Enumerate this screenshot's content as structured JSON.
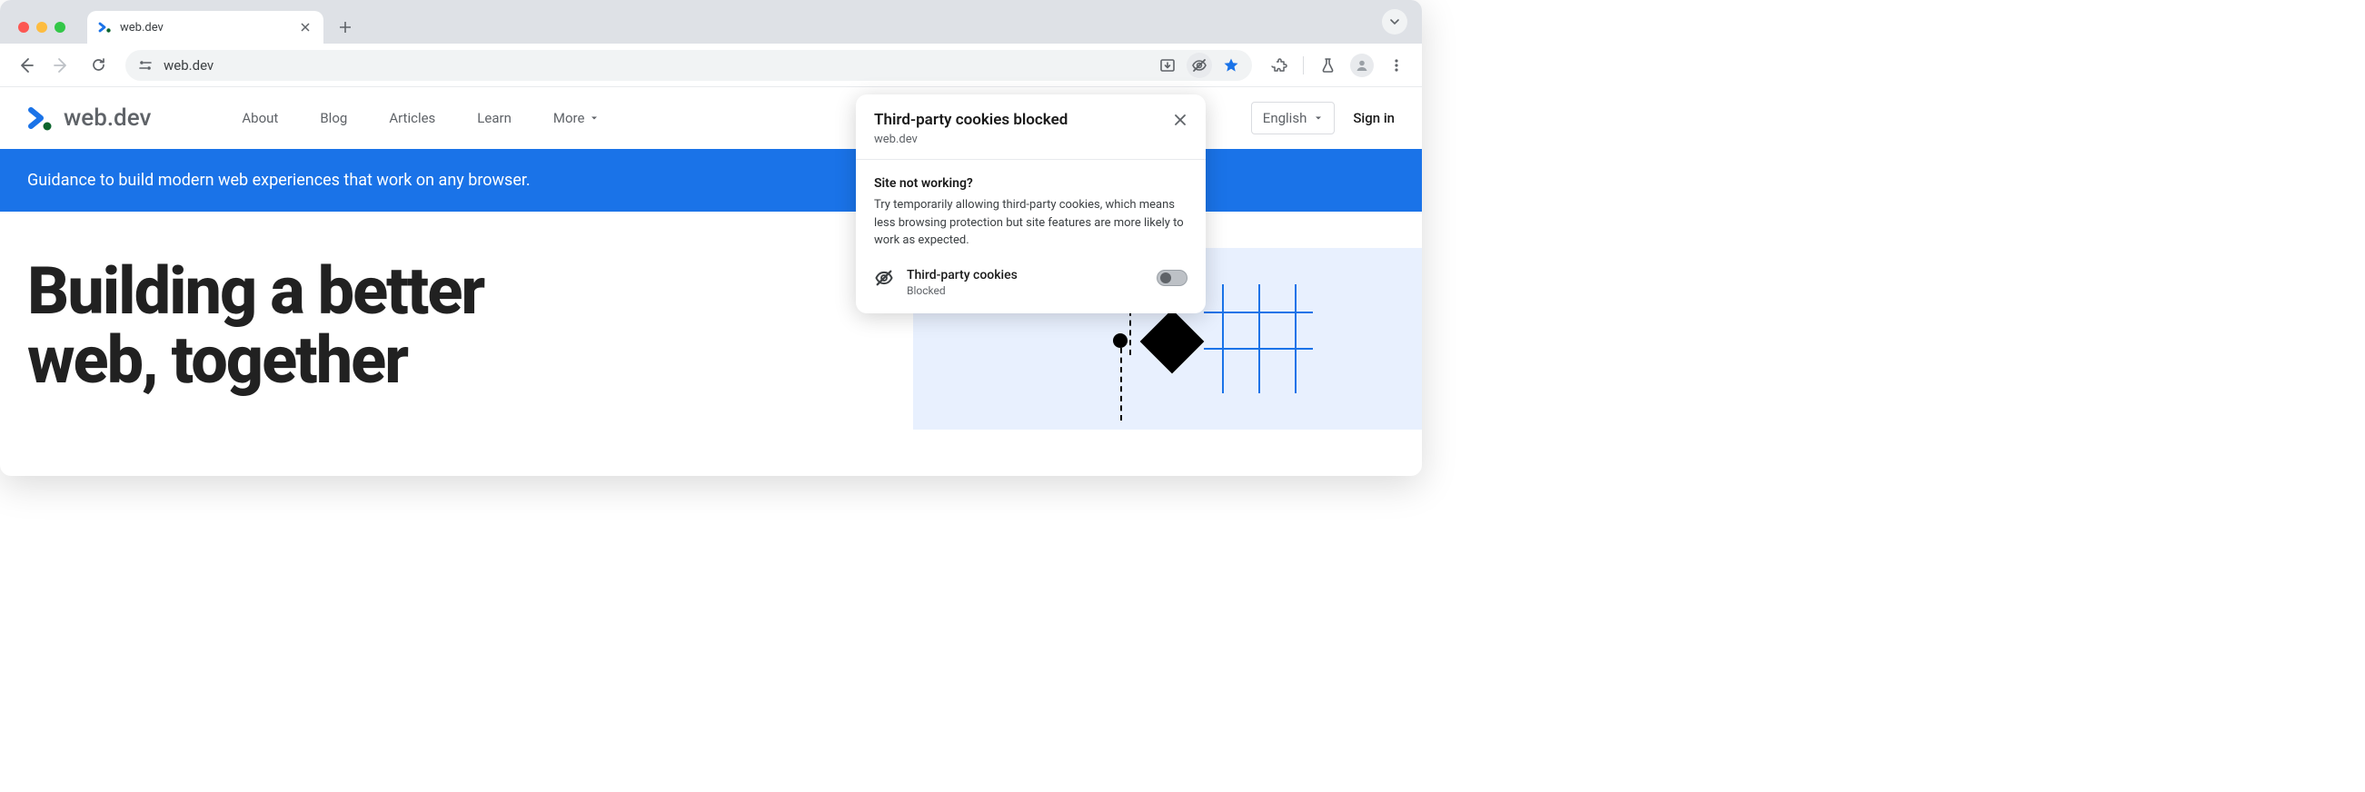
{
  "tab": {
    "title": "web.dev"
  },
  "omnibox": {
    "url": "web.dev"
  },
  "site": {
    "logo_text": "web.dev",
    "nav": {
      "about": "About",
      "blog": "Blog",
      "articles": "Articles",
      "learn": "Learn",
      "more": "More"
    },
    "lang": "English",
    "signin": "Sign in",
    "banner": "Guidance to build modern web experiences that work on any browser.",
    "hero_line1": "Building a better",
    "hero_line2": "web, together"
  },
  "popover": {
    "title": "Third-party cookies blocked",
    "site": "web.dev",
    "question": "Site not working?",
    "description": "Try temporarily allowing third-party cookies, which means less browsing protection but site features are more likely to work as expected.",
    "toggle_label": "Third-party cookies",
    "toggle_status": "Blocked"
  }
}
